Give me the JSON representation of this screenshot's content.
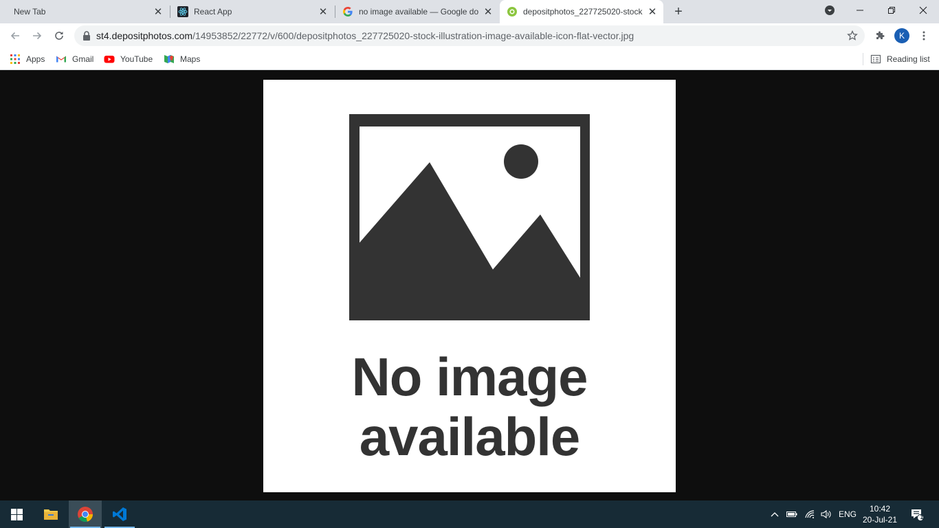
{
  "tabs": [
    {
      "title": "New Tab"
    },
    {
      "title": "React App"
    },
    {
      "title": "no image available — Google do"
    },
    {
      "title": "depositphotos_227725020-stock"
    }
  ],
  "address_bar": {
    "host": "st4.depositphotos.com",
    "path": "/14953852/22772/v/600/depositphotos_227725020-stock-illustration-image-available-icon-flat-vector.jpg"
  },
  "profile": {
    "initial": "K"
  },
  "bookmarks": {
    "items": [
      {
        "label": "Apps"
      },
      {
        "label": "Gmail"
      },
      {
        "label": "YouTube"
      },
      {
        "label": "Maps"
      }
    ],
    "reading_list": "Reading list"
  },
  "content": {
    "line1": "No image",
    "line2": "available"
  },
  "taskbar": {
    "language": "ENG",
    "time": "10:42",
    "date": "20-Jul-21",
    "notification_count": "1"
  },
  "colors": {
    "placeholder_gray": "#333333",
    "accent_blue": "#1a73e8"
  }
}
